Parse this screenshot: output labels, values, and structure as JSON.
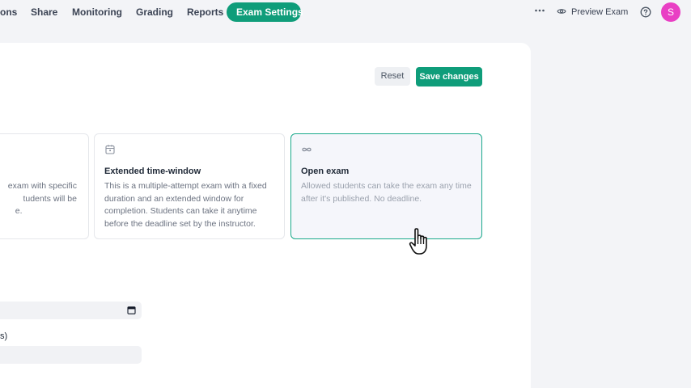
{
  "nav": {
    "tabs": [
      {
        "label": "ons"
      },
      {
        "label": "Share"
      },
      {
        "label": "Monitoring"
      },
      {
        "label": "Grading"
      },
      {
        "label": "Reports"
      },
      {
        "label": "Exam Settings",
        "active": true
      }
    ],
    "preview_label": "Preview Exam",
    "avatar_initial": "S",
    "icons": {
      "more": "more-dots-icon",
      "preview": "eye-icon",
      "help": "help-circle-icon"
    }
  },
  "toolbar": {
    "reset_label": "Reset",
    "save_label": "Save changes"
  },
  "modes": [
    {
      "title": "",
      "desc_lines": [
        "exam with specific",
        "tudents will be",
        "e."
      ],
      "icon": ""
    },
    {
      "title": "Extended time-window",
      "desc": "This is a multiple-attempt exam with a fixed duration and an extended window for completion. Students can take it anytime before the deadline set by the instructor.",
      "icon": "calendar-icon"
    },
    {
      "title": "Open exam",
      "desc": "Allowed students can take the exam any time after it's published. No deadline.",
      "icon": "infinity-icon",
      "selected": true
    }
  ],
  "fields": {
    "date_value": "",
    "label_fragment": "s)",
    "second_value": ""
  },
  "colors": {
    "accent": "#0f9d7a",
    "avatar": "#e93fc4",
    "selected_border": "#1aa98b"
  }
}
